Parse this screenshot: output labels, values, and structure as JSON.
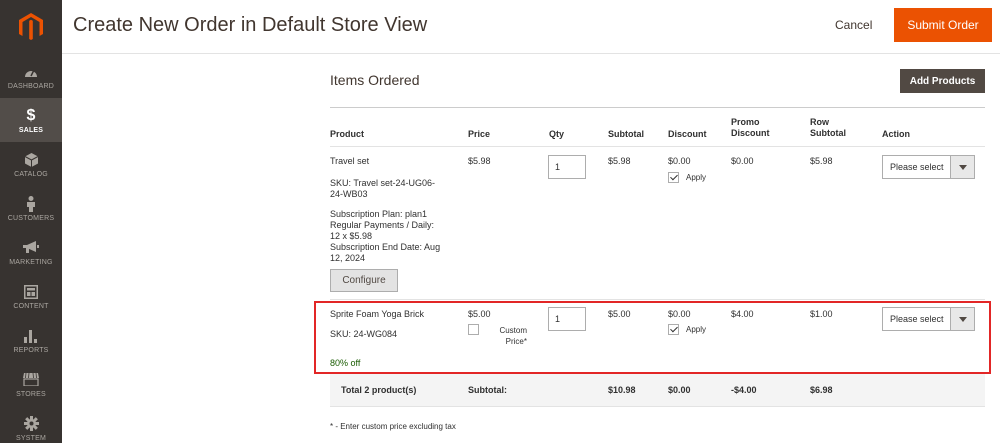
{
  "sidebar": {
    "items": [
      {
        "label": "DASHBOARD",
        "icon": "dashboard-icon"
      },
      {
        "label": "SALES",
        "icon": "dollar-icon",
        "active": true
      },
      {
        "label": "CATALOG",
        "icon": "cube-icon"
      },
      {
        "label": "CUSTOMERS",
        "icon": "person-icon"
      },
      {
        "label": "MARKETING",
        "icon": "megaphone-icon"
      },
      {
        "label": "CONTENT",
        "icon": "layout-icon"
      },
      {
        "label": "REPORTS",
        "icon": "bar-chart-icon"
      },
      {
        "label": "STORES",
        "icon": "store-icon"
      },
      {
        "label": "SYSTEM",
        "icon": "gear-icon"
      }
    ]
  },
  "header": {
    "title": "Create New Order in Default Store View",
    "cancel_label": "Cancel",
    "submit_label": "Submit Order"
  },
  "items_ordered": {
    "title": "Items Ordered",
    "add_products_label": "Add Products",
    "columns": {
      "product": "Product",
      "price": "Price",
      "qty": "Qty",
      "subtotal": "Subtotal",
      "discount": "Discount",
      "promo_1": "Promo",
      "promo_2": "Discount",
      "row_1": "Row",
      "row_2": "Subtotal",
      "action": "Action"
    },
    "rows": [
      {
        "name": "Travel set",
        "sku_1": "SKU: Travel set-24-UG06-",
        "sku_2": "24-WB03",
        "plan_1": "Subscription Plan: plan1",
        "plan_2": "Regular Payments / Daily:",
        "plan_3": "12 x $5.98",
        "plan_4": "Subscription End Date: Aug",
        "plan_5": "12, 2024",
        "configure_label": "Configure",
        "price": "$5.98",
        "qty": "1",
        "subtotal": "$5.98",
        "discount": "$0.00",
        "apply_label": "Apply",
        "promo_discount": "$0.00",
        "row_subtotal": "$5.98",
        "action_placeholder": "Please select"
      },
      {
        "name": "Sprite Foam Yoga Brick",
        "sku_1": "SKU: 24-WG084",
        "discount_note": "80% off",
        "price": "$5.00",
        "custom_price_1": "Custom",
        "custom_price_2": "Price*",
        "qty": "1",
        "subtotal": "$5.00",
        "discount": "$0.00",
        "apply_label": "Apply",
        "promo_discount": "$4.00",
        "row_subtotal": "$1.00",
        "action_placeholder": "Please select"
      }
    ],
    "totals": {
      "label": "Total 2 product(s)",
      "subtotal_label": "Subtotal:",
      "subtotal": "$10.98",
      "discount": "$0.00",
      "promo_discount": "-$4.00",
      "row_subtotal": "$6.98"
    },
    "footnote": "* - Enter custom price excluding tax"
  },
  "colors": {
    "sidebar_bg": "#373330",
    "primary_button": "#eb5202",
    "secondary_button": "#514943",
    "highlight_border": "#e22626",
    "discount_text": "#185b00"
  }
}
